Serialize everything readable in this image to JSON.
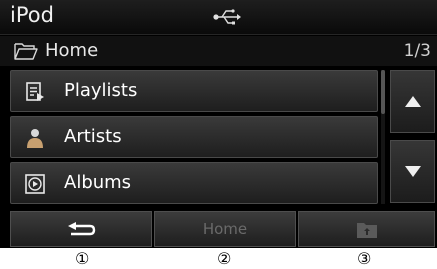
{
  "status_bar": {
    "title": "iPod",
    "usb_icon": "usb-icon"
  },
  "folder": {
    "icon": "folder-icon",
    "label": "Home",
    "page": "1/3"
  },
  "list": {
    "items": [
      {
        "label": "Playlists",
        "icon": "playlist-icon"
      },
      {
        "label": "Artists",
        "icon": "artist-icon"
      },
      {
        "label": "Albums",
        "icon": "album-icon"
      }
    ]
  },
  "scroll": {
    "up_icon": "arrow-up-icon",
    "down_icon": "arrow-down-icon"
  },
  "bottom": {
    "back_icon": "back-arrow-icon",
    "home_label": "Home",
    "upfolder_icon": "folder-up-icon"
  },
  "callouts": [
    "①",
    "②",
    "③"
  ],
  "colors": {
    "background": "#000000",
    "button": "#2c2c2c",
    "text": "#ffffff",
    "disabled": "#6a6a6a"
  }
}
